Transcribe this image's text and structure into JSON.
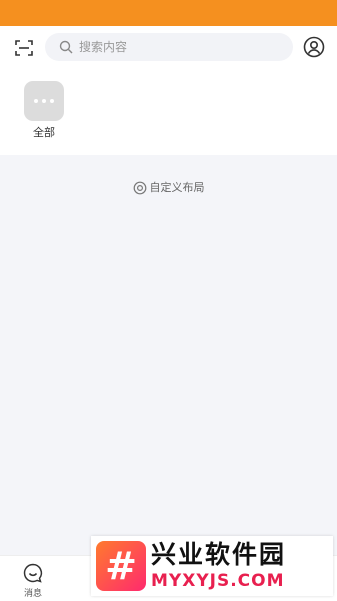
{
  "header": {
    "search_placeholder": "搜索内容",
    "scan_icon": "scan-icon",
    "profile_icon": "user-circle-icon"
  },
  "apps": [
    {
      "label": "全部",
      "icon": "more-dots-icon"
    }
  ],
  "main": {
    "customize_label": "自定义布局",
    "customize_icon": "settings-icon"
  },
  "tabbar": {
    "tabs": [
      {
        "label": "消息",
        "icon": "message-icon"
      }
    ]
  },
  "watermark": {
    "logo_glyph": "#",
    "title": "兴业软件园",
    "url": "MYXYJS.COM"
  },
  "colors": {
    "status_bar": "#f5901f",
    "page_background": "#f4f5f9",
    "watermark_url": "#e8204f"
  }
}
